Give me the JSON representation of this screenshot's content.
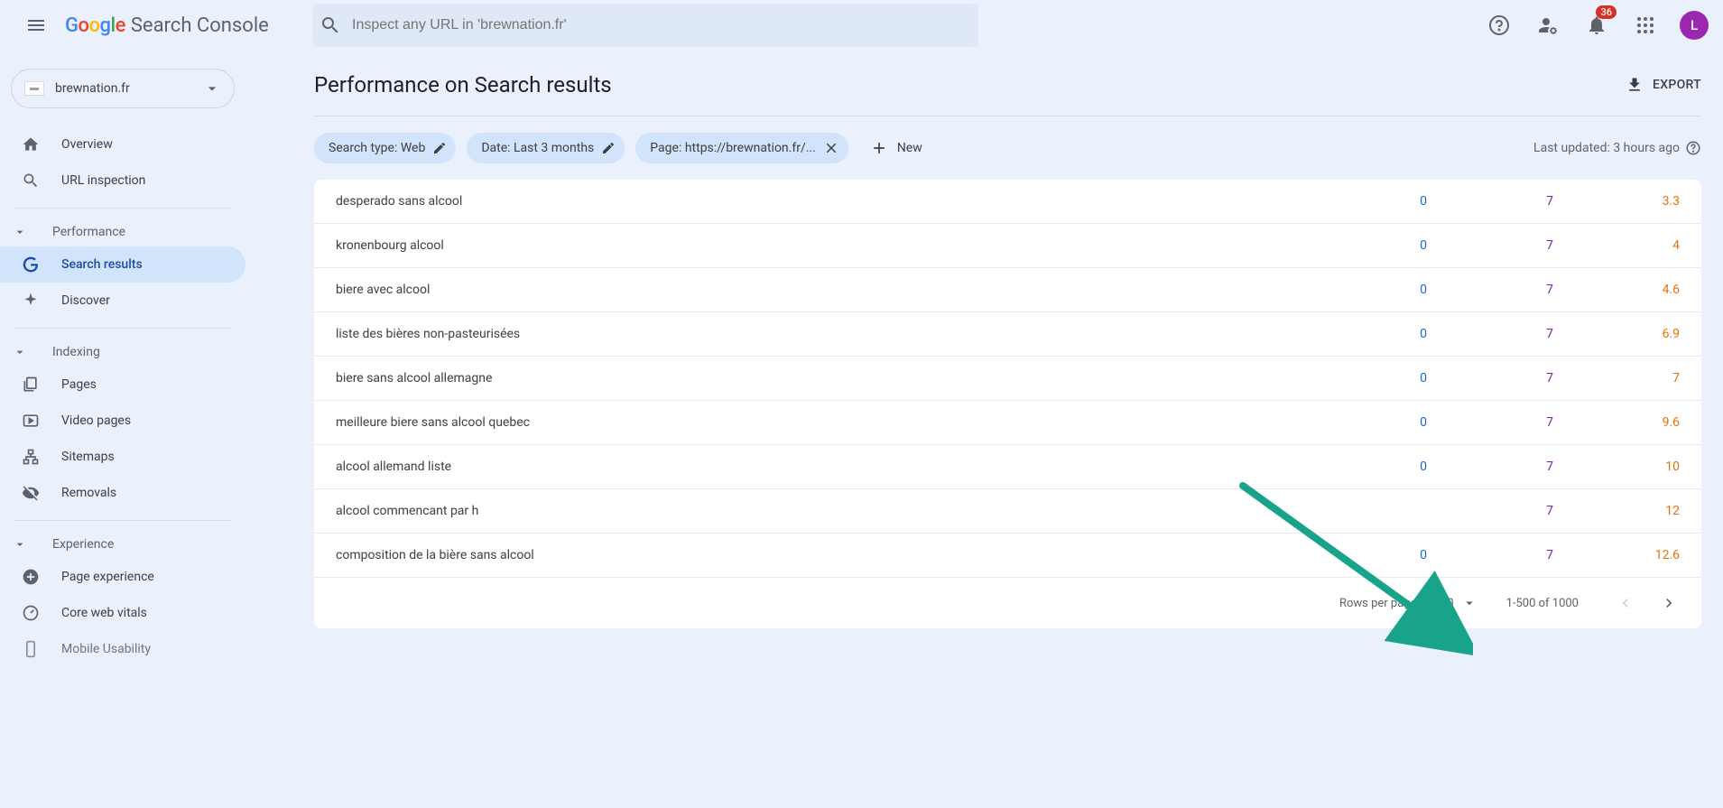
{
  "header": {
    "product": "Search Console",
    "search_placeholder": "Inspect any URL in 'brewnation.fr'",
    "notifications_count": "36",
    "avatar_initial": "L"
  },
  "sidebar": {
    "property": "brewnation.fr",
    "nav": {
      "overview": "Overview",
      "url_inspection": "URL inspection"
    },
    "sections": {
      "performance": "Performance",
      "indexing": "Indexing",
      "experience": "Experience"
    },
    "performance_items": {
      "search_results": "Search results",
      "discover": "Discover"
    },
    "indexing_items": {
      "pages": "Pages",
      "video_pages": "Video pages",
      "sitemaps": "Sitemaps",
      "removals": "Removals"
    },
    "experience_items": {
      "page_experience": "Page experience",
      "core_web_vitals": "Core web vitals",
      "mobile_usability": "Mobile Usability"
    }
  },
  "page": {
    "title": "Performance on Search results",
    "export": "EXPORT",
    "last_updated": "Last updated: 3 hours ago"
  },
  "filters": {
    "search_type": "Search type: Web",
    "date": "Date: Last 3 months",
    "page_filter": "Page: https://brewnation.fr/...",
    "new": "New"
  },
  "table": {
    "rows": [
      {
        "query": "desperado sans alcool",
        "clicks": "0",
        "impressions": "7",
        "position": "3.3"
      },
      {
        "query": "kronenbourg alcool",
        "clicks": "0",
        "impressions": "7",
        "position": "4"
      },
      {
        "query": "biere avec alcool",
        "clicks": "0",
        "impressions": "7",
        "position": "4.6"
      },
      {
        "query": "liste des bières non-pasteurisées",
        "clicks": "0",
        "impressions": "7",
        "position": "6.9"
      },
      {
        "query": "biere sans alcool allemagne",
        "clicks": "0",
        "impressions": "7",
        "position": "7"
      },
      {
        "query": "meilleure biere sans alcool quebec",
        "clicks": "0",
        "impressions": "7",
        "position": "9.6"
      },
      {
        "query": "alcool allemand liste",
        "clicks": "0",
        "impressions": "7",
        "position": "10"
      },
      {
        "query": "alcool commencant par h",
        "clicks": "",
        "impressions": "7",
        "position": "12"
      },
      {
        "query": "composition de la bière sans alcool",
        "clicks": "0",
        "impressions": "7",
        "position": "12.6"
      }
    ]
  },
  "pagination": {
    "rows_label": "Rows per page:",
    "rows_value": "500",
    "range": "1-500 of 1000"
  }
}
